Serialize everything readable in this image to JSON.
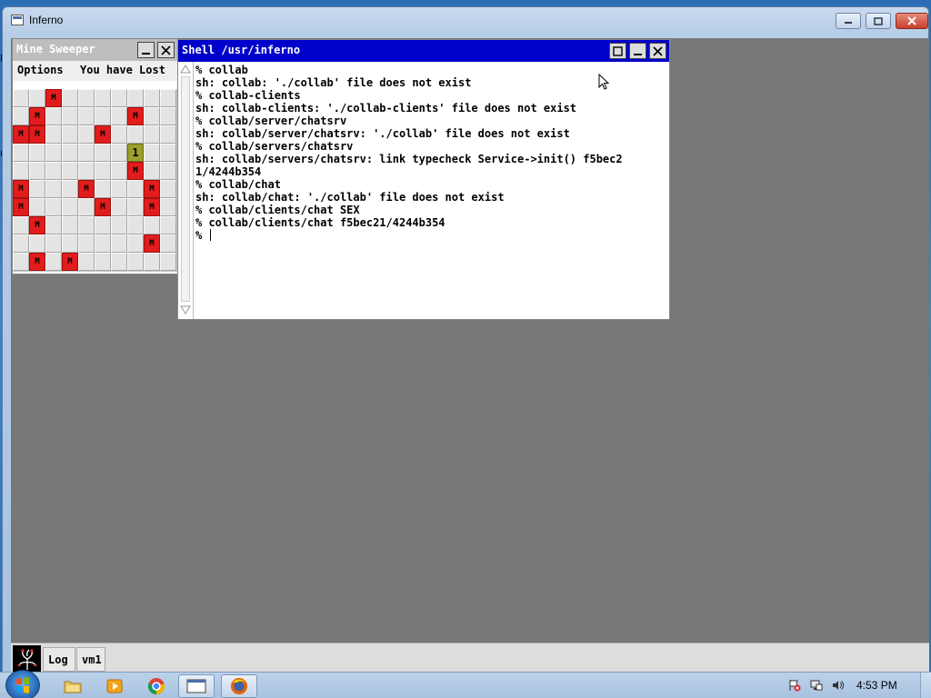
{
  "win7_window": {
    "title": "Inferno"
  },
  "minesweeper": {
    "title": "Mine Sweeper",
    "menu_label": "Options",
    "status": "You have Lost",
    "grid": [
      [
        "",
        "",
        "M",
        "",
        "",
        "",
        "",
        "",
        "",
        ""
      ],
      [
        "",
        "M",
        "",
        "",
        "",
        "",
        "",
        "M",
        "",
        ""
      ],
      [
        "M",
        "M",
        "",
        "",
        "",
        "M",
        "",
        "",
        "",
        ""
      ],
      [
        "",
        "",
        "",
        "",
        "",
        "",
        "",
        "1",
        "",
        ""
      ],
      [
        "",
        "",
        "",
        "",
        "",
        "",
        "",
        "M",
        "",
        ""
      ],
      [
        "M",
        "",
        "",
        "",
        "M",
        "",
        "",
        "",
        "M",
        ""
      ],
      [
        "M",
        "",
        "",
        "",
        "",
        "M",
        "",
        "",
        "M",
        ""
      ],
      [
        "",
        "M",
        "",
        "",
        "",
        "",
        "",
        "",
        "",
        ""
      ],
      [
        "",
        "",
        "",
        "",
        "",
        "",
        "",
        "",
        "M",
        ""
      ],
      [
        "",
        "M",
        "",
        "M",
        "",
        "",
        "",
        "",
        "",
        ""
      ]
    ]
  },
  "shell": {
    "title": "Shell /usr/inferno",
    "lines": [
      "% collab",
      "sh: collab: './collab' file does not exist",
      "% collab-clients",
      "sh: collab-clients: './collab-clients' file does not exist",
      "% collab/server/chatsrv",
      "sh: collab/server/chatsrv: './collab' file does not exist",
      "% collab/servers/chatsrv",
      "sh: collab/servers/chatsrv: link typecheck Service->init() f5bec2",
      "1/4244b354",
      "% collab/chat",
      "sh: collab/chat: './collab' file does not exist",
      "% collab/clients/chat SEX",
      "% collab/clients/chat f5bec21/4244b354"
    ],
    "prompt": "% "
  },
  "inferno_bar": {
    "tabs": [
      "Log",
      "vm1"
    ]
  },
  "taskbar": {
    "time": "4:53 PM",
    "apps": [
      "explorer-icon",
      "media-player-icon",
      "chrome-icon",
      "window-app-icon",
      "firefox-icon"
    ]
  },
  "colors": {
    "shell_titlebar": "#0000cc",
    "mine": "#e21c1c",
    "desktop": "#777777"
  }
}
